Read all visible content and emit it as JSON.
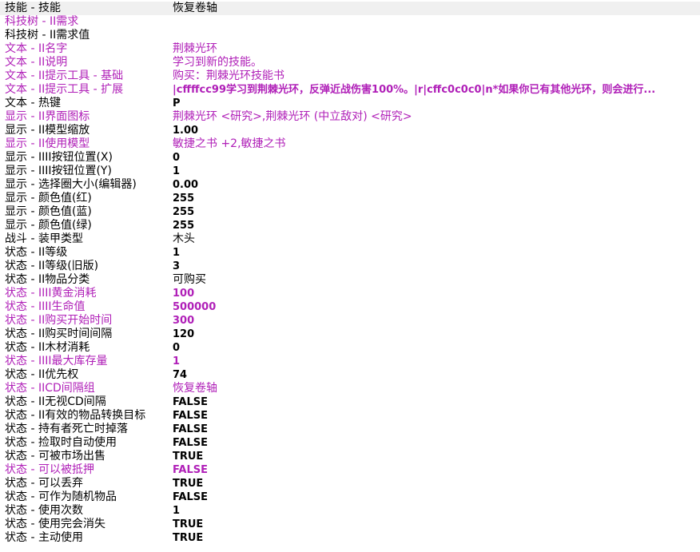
{
  "colors": {
    "modified": "#b020b8",
    "default": "#000000",
    "selected_row_bg": "#f0f0f0"
  },
  "fields": [
    {
      "key": "技能 - 技能",
      "value": "恢复卷轴",
      "modified": false,
      "selected": true
    },
    {
      "key": "科技树 - II需求",
      "value": "",
      "modified": true
    },
    {
      "key": "科技树 - II需求值",
      "value": "",
      "modified": false
    },
    {
      "key": "文本 - II名字",
      "value": "荆棘光环",
      "modified": true
    },
    {
      "key": "文本 - II说明",
      "value": "学习到新的技能。",
      "modified": true
    },
    {
      "key": "文本 - II提示工具 - 基础",
      "value": "购买：荆棘光环技能书",
      "modified": true
    },
    {
      "key": "文本 - II提示工具 - 扩展",
      "value": "|cffffcc99学习到荆棘光环，反弹近战伤害100%。|r|cffc0c0c0|n*如果你已有其他光环，则会进行...",
      "modified": true
    },
    {
      "key": "文本 - 热键",
      "value": "P",
      "modified": false
    },
    {
      "key": "显示 - II界面图标",
      "value": "荆棘光环 <研究>,荆棘光环 (中立敌对) <研究>",
      "modified": true
    },
    {
      "key": "显示 - II模型缩放",
      "value": "1.00",
      "modified": false
    },
    {
      "key": "显示 - II使用模型",
      "value": "敏捷之书 +2,敏捷之书",
      "modified": true
    },
    {
      "key": "显示 - IIII按钮位置(X)",
      "value": "0",
      "modified": false
    },
    {
      "key": "显示 - IIII按钮位置(Y)",
      "value": "1",
      "modified": false
    },
    {
      "key": "显示 - 选择圈大小(编辑器)",
      "value": "0.00",
      "modified": false
    },
    {
      "key": "显示 - 颜色值(红)",
      "value": "255",
      "modified": false
    },
    {
      "key": "显示 - 颜色值(蓝)",
      "value": "255",
      "modified": false
    },
    {
      "key": "显示 - 颜色值(绿)",
      "value": "255",
      "modified": false
    },
    {
      "key": "战斗 - 装甲类型",
      "value": "木头",
      "modified": false
    },
    {
      "key": "状态 - II等级",
      "value": "1",
      "modified": false
    },
    {
      "key": "状态 - II等级(旧版)",
      "value": "3",
      "modified": false
    },
    {
      "key": "状态 - II物品分类",
      "value": "可购买",
      "modified": false
    },
    {
      "key": "状态 - IIII黄金消耗",
      "value": "100",
      "modified": true
    },
    {
      "key": "状态 - IIII生命值",
      "value": "500000",
      "modified": true
    },
    {
      "key": "状态 - II购买开始时间",
      "value": "300",
      "modified": true
    },
    {
      "key": "状态 - II购买时间间隔",
      "value": "120",
      "modified": false
    },
    {
      "key": "状态 - II木材消耗",
      "value": "0",
      "modified": false
    },
    {
      "key": "状态 - IIII最大库存量",
      "value": "1",
      "modified": true
    },
    {
      "key": "状态 - II优先权",
      "value": "74",
      "modified": false
    },
    {
      "key": "状态 - IICD间隔组",
      "value": "恢复卷轴",
      "modified": true
    },
    {
      "key": "状态 - II无视CD间隔",
      "value": "FALSE",
      "modified": false
    },
    {
      "key": "状态 - II有效的物品转换目标",
      "value": "FALSE",
      "modified": false
    },
    {
      "key": "状态 - 持有者死亡时掉落",
      "value": "FALSE",
      "modified": false
    },
    {
      "key": "状态 - 捡取时自动使用",
      "value": "FALSE",
      "modified": false
    },
    {
      "key": "状态 - 可被市场出售",
      "value": "TRUE",
      "modified": false
    },
    {
      "key": "状态 - 可以被抵押",
      "value": "FALSE",
      "modified": true
    },
    {
      "key": "状态 - 可以丢弃",
      "value": "TRUE",
      "modified": false
    },
    {
      "key": "状态 - 可作为随机物品",
      "value": "FALSE",
      "modified": false
    },
    {
      "key": "状态 - 使用次数",
      "value": "1",
      "modified": false
    },
    {
      "key": "状态 - 使用完会消失",
      "value": "TRUE",
      "modified": false
    },
    {
      "key": "状态 - 主动使用",
      "value": "TRUE",
      "modified": false
    }
  ]
}
